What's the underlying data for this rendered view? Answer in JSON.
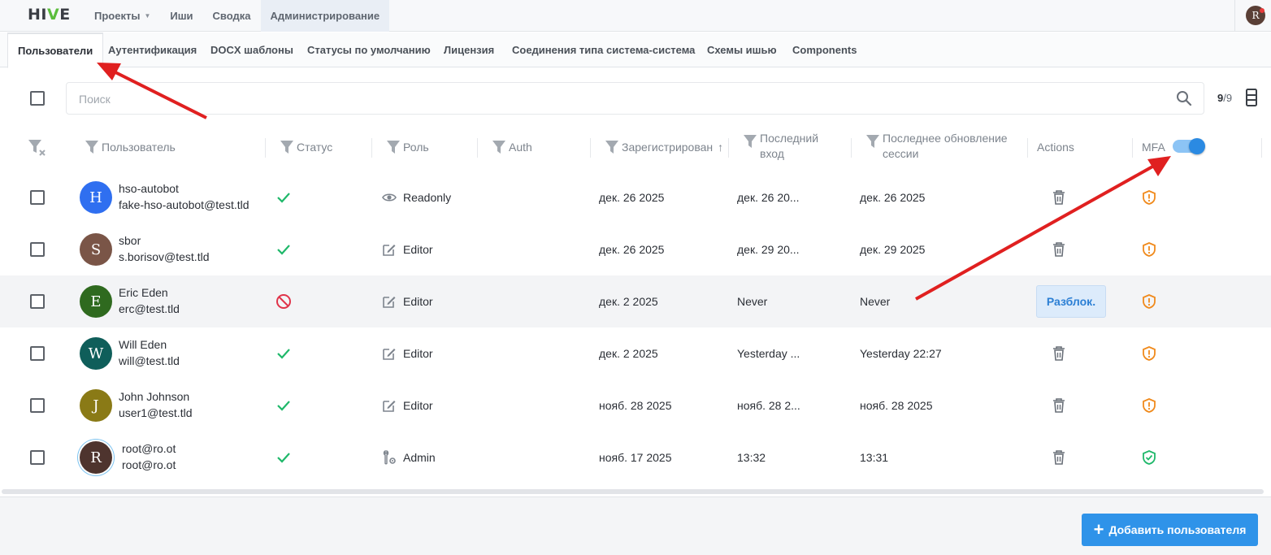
{
  "app": {
    "logo_left": "HI",
    "logo_v": "V",
    "logo_right": "E"
  },
  "topnav": {
    "items": [
      {
        "label": "Проекты"
      },
      {
        "label": "Иши"
      },
      {
        "label": "Сводка"
      },
      {
        "label": "Администрирование"
      }
    ],
    "user_initial": "R"
  },
  "tabs": [
    {
      "label": "Пользователи"
    },
    {
      "label": "Аутентификация"
    },
    {
      "label": "DOCX шаблоны"
    },
    {
      "label": "Статусы по умолчанию"
    },
    {
      "label": "Лицензия"
    },
    {
      "label": "Соединения типа система-система"
    },
    {
      "label": "Схемы ишью"
    },
    {
      "label": "Components"
    }
  ],
  "search": {
    "placeholder": "Поиск",
    "count_shown": "9",
    "count_total": "/9"
  },
  "columns": {
    "user": "Пользователь",
    "status": "Статус",
    "role": "Роль",
    "auth": "Auth",
    "registered": "Зарегистрирован",
    "last_login_1": "Последний",
    "last_login_2": "вход",
    "session_1": "Последнее обновление",
    "session_2": "сессии",
    "actions": "Actions",
    "mfa": "MFA",
    "sort_arrow": "↑"
  },
  "mfa_toggle_on": true,
  "users": [
    {
      "initial": "H",
      "avatar_color": "#2f6ff0",
      "name": "hso-autobot",
      "email": "fake-hso-autobot@test.tld",
      "status": "active",
      "role_icon": "eye-icon",
      "role": "Readonly",
      "registered": "дек. 26 2025",
      "last_login": "дек. 26 20...",
      "session": "дек. 26 2025",
      "action": "delete",
      "mfa": "warning"
    },
    {
      "initial": "S",
      "avatar_color": "#7a5547",
      "name": "sbor",
      "email": "s.borisov@test.tld",
      "status": "active",
      "role_icon": "edit-icon",
      "role": "Editor",
      "registered": "дек. 26 2025",
      "last_login": "дек. 29 20...",
      "session": "дек. 29 2025",
      "action": "delete",
      "mfa": "warning"
    },
    {
      "initial": "E",
      "avatar_color": "#2f6a1f",
      "name": "Eric Eden",
      "email": "erc@test.tld",
      "status": "blocked",
      "role_icon": "edit-icon",
      "role": "Editor",
      "registered": "дек. 2 2025",
      "last_login": "Never",
      "session": "Never",
      "action": "unlock",
      "action_label": "Разблок.",
      "mfa": "warning"
    },
    {
      "initial": "W",
      "avatar_color": "#0f5e5a",
      "name": "Will Eden",
      "email": "will@test.tld",
      "status": "active",
      "role_icon": "edit-icon",
      "role": "Editor",
      "registered": "дек. 2 2025",
      "last_login": "Yesterday ...",
      "session": "Yesterday 22:27",
      "action": "delete",
      "mfa": "warning"
    },
    {
      "initial": "J",
      "avatar_color": "#8a7a16",
      "name": "John Johnson",
      "email": "user1@test.tld",
      "status": "active",
      "role_icon": "edit-icon",
      "role": "Editor",
      "registered": "нояб. 28 2025",
      "last_login": "нояб. 28 2...",
      "session": "нояб. 28 2025",
      "action": "delete",
      "mfa": "warning"
    },
    {
      "initial": "R",
      "avatar_color": "#4e342e",
      "name": "root@ro.ot",
      "email": "root@ro.ot",
      "status": "active",
      "role_icon": "admin-icon",
      "role": "Admin",
      "registered": "нояб. 17 2025",
      "last_login": "13:32",
      "session": "13:31",
      "action": "delete",
      "mfa": "ok"
    }
  ],
  "footer": {
    "add_button": "Добавить пользователя"
  },
  "colors": {
    "accent": "#2f93e9",
    "success": "#1fb86a",
    "danger": "#e0344a",
    "warning": "#f08a1c",
    "annotation": "#e02020"
  }
}
